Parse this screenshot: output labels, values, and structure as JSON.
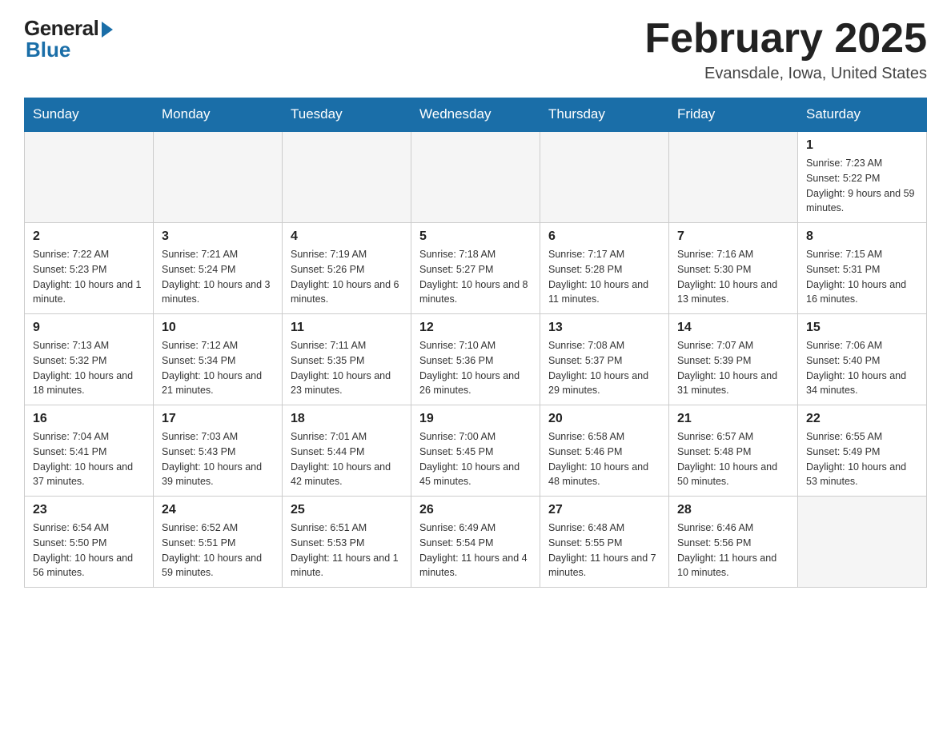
{
  "header": {
    "logo_general": "General",
    "logo_blue": "Blue",
    "title": "February 2025",
    "location": "Evansdale, Iowa, United States"
  },
  "days_of_week": [
    "Sunday",
    "Monday",
    "Tuesday",
    "Wednesday",
    "Thursday",
    "Friday",
    "Saturday"
  ],
  "weeks": [
    [
      {
        "day": "",
        "info": ""
      },
      {
        "day": "",
        "info": ""
      },
      {
        "day": "",
        "info": ""
      },
      {
        "day": "",
        "info": ""
      },
      {
        "day": "",
        "info": ""
      },
      {
        "day": "",
        "info": ""
      },
      {
        "day": "1",
        "info": "Sunrise: 7:23 AM\nSunset: 5:22 PM\nDaylight: 9 hours and 59 minutes."
      }
    ],
    [
      {
        "day": "2",
        "info": "Sunrise: 7:22 AM\nSunset: 5:23 PM\nDaylight: 10 hours and 1 minute."
      },
      {
        "day": "3",
        "info": "Sunrise: 7:21 AM\nSunset: 5:24 PM\nDaylight: 10 hours and 3 minutes."
      },
      {
        "day": "4",
        "info": "Sunrise: 7:19 AM\nSunset: 5:26 PM\nDaylight: 10 hours and 6 minutes."
      },
      {
        "day": "5",
        "info": "Sunrise: 7:18 AM\nSunset: 5:27 PM\nDaylight: 10 hours and 8 minutes."
      },
      {
        "day": "6",
        "info": "Sunrise: 7:17 AM\nSunset: 5:28 PM\nDaylight: 10 hours and 11 minutes."
      },
      {
        "day": "7",
        "info": "Sunrise: 7:16 AM\nSunset: 5:30 PM\nDaylight: 10 hours and 13 minutes."
      },
      {
        "day": "8",
        "info": "Sunrise: 7:15 AM\nSunset: 5:31 PM\nDaylight: 10 hours and 16 minutes."
      }
    ],
    [
      {
        "day": "9",
        "info": "Sunrise: 7:13 AM\nSunset: 5:32 PM\nDaylight: 10 hours and 18 minutes."
      },
      {
        "day": "10",
        "info": "Sunrise: 7:12 AM\nSunset: 5:34 PM\nDaylight: 10 hours and 21 minutes."
      },
      {
        "day": "11",
        "info": "Sunrise: 7:11 AM\nSunset: 5:35 PM\nDaylight: 10 hours and 23 minutes."
      },
      {
        "day": "12",
        "info": "Sunrise: 7:10 AM\nSunset: 5:36 PM\nDaylight: 10 hours and 26 minutes."
      },
      {
        "day": "13",
        "info": "Sunrise: 7:08 AM\nSunset: 5:37 PM\nDaylight: 10 hours and 29 minutes."
      },
      {
        "day": "14",
        "info": "Sunrise: 7:07 AM\nSunset: 5:39 PM\nDaylight: 10 hours and 31 minutes."
      },
      {
        "day": "15",
        "info": "Sunrise: 7:06 AM\nSunset: 5:40 PM\nDaylight: 10 hours and 34 minutes."
      }
    ],
    [
      {
        "day": "16",
        "info": "Sunrise: 7:04 AM\nSunset: 5:41 PM\nDaylight: 10 hours and 37 minutes."
      },
      {
        "day": "17",
        "info": "Sunrise: 7:03 AM\nSunset: 5:43 PM\nDaylight: 10 hours and 39 minutes."
      },
      {
        "day": "18",
        "info": "Sunrise: 7:01 AM\nSunset: 5:44 PM\nDaylight: 10 hours and 42 minutes."
      },
      {
        "day": "19",
        "info": "Sunrise: 7:00 AM\nSunset: 5:45 PM\nDaylight: 10 hours and 45 minutes."
      },
      {
        "day": "20",
        "info": "Sunrise: 6:58 AM\nSunset: 5:46 PM\nDaylight: 10 hours and 48 minutes."
      },
      {
        "day": "21",
        "info": "Sunrise: 6:57 AM\nSunset: 5:48 PM\nDaylight: 10 hours and 50 minutes."
      },
      {
        "day": "22",
        "info": "Sunrise: 6:55 AM\nSunset: 5:49 PM\nDaylight: 10 hours and 53 minutes."
      }
    ],
    [
      {
        "day": "23",
        "info": "Sunrise: 6:54 AM\nSunset: 5:50 PM\nDaylight: 10 hours and 56 minutes."
      },
      {
        "day": "24",
        "info": "Sunrise: 6:52 AM\nSunset: 5:51 PM\nDaylight: 10 hours and 59 minutes."
      },
      {
        "day": "25",
        "info": "Sunrise: 6:51 AM\nSunset: 5:53 PM\nDaylight: 11 hours and 1 minute."
      },
      {
        "day": "26",
        "info": "Sunrise: 6:49 AM\nSunset: 5:54 PM\nDaylight: 11 hours and 4 minutes."
      },
      {
        "day": "27",
        "info": "Sunrise: 6:48 AM\nSunset: 5:55 PM\nDaylight: 11 hours and 7 minutes."
      },
      {
        "day": "28",
        "info": "Sunrise: 6:46 AM\nSunset: 5:56 PM\nDaylight: 11 hours and 10 minutes."
      },
      {
        "day": "",
        "info": ""
      }
    ]
  ]
}
